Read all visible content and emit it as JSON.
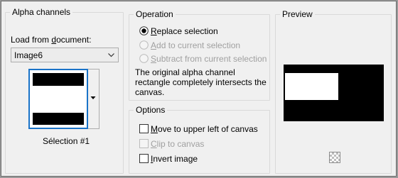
{
  "alpha_channels": {
    "title": "Alpha channels",
    "load_label": "Load from document:",
    "document_value": "Image6",
    "selection_name": "Sélection #1"
  },
  "operation": {
    "title": "Operation",
    "options": [
      {
        "label": "Replace selection",
        "selected": true,
        "enabled": true
      },
      {
        "label": "Add to current selection",
        "selected": false,
        "enabled": false
      },
      {
        "label": "Subtract from current selection",
        "selected": false,
        "enabled": false
      }
    ],
    "description": "The original alpha channel rectangle completely intersects the canvas."
  },
  "options": {
    "title": "Options",
    "checkboxes": [
      {
        "label": "Move to upper left of canvas",
        "checked": false,
        "enabled": true
      },
      {
        "label": "Clip to canvas",
        "checked": false,
        "enabled": false
      },
      {
        "label": "Invert image",
        "checked": false,
        "enabled": true
      }
    ]
  },
  "preview": {
    "title": "Preview",
    "background_icon": "checkerboard-icon"
  },
  "colors": {
    "dialog_bg": "#f0f0f0",
    "focus_border": "#1a73c8",
    "disabled_text": "#a0a0a0"
  }
}
